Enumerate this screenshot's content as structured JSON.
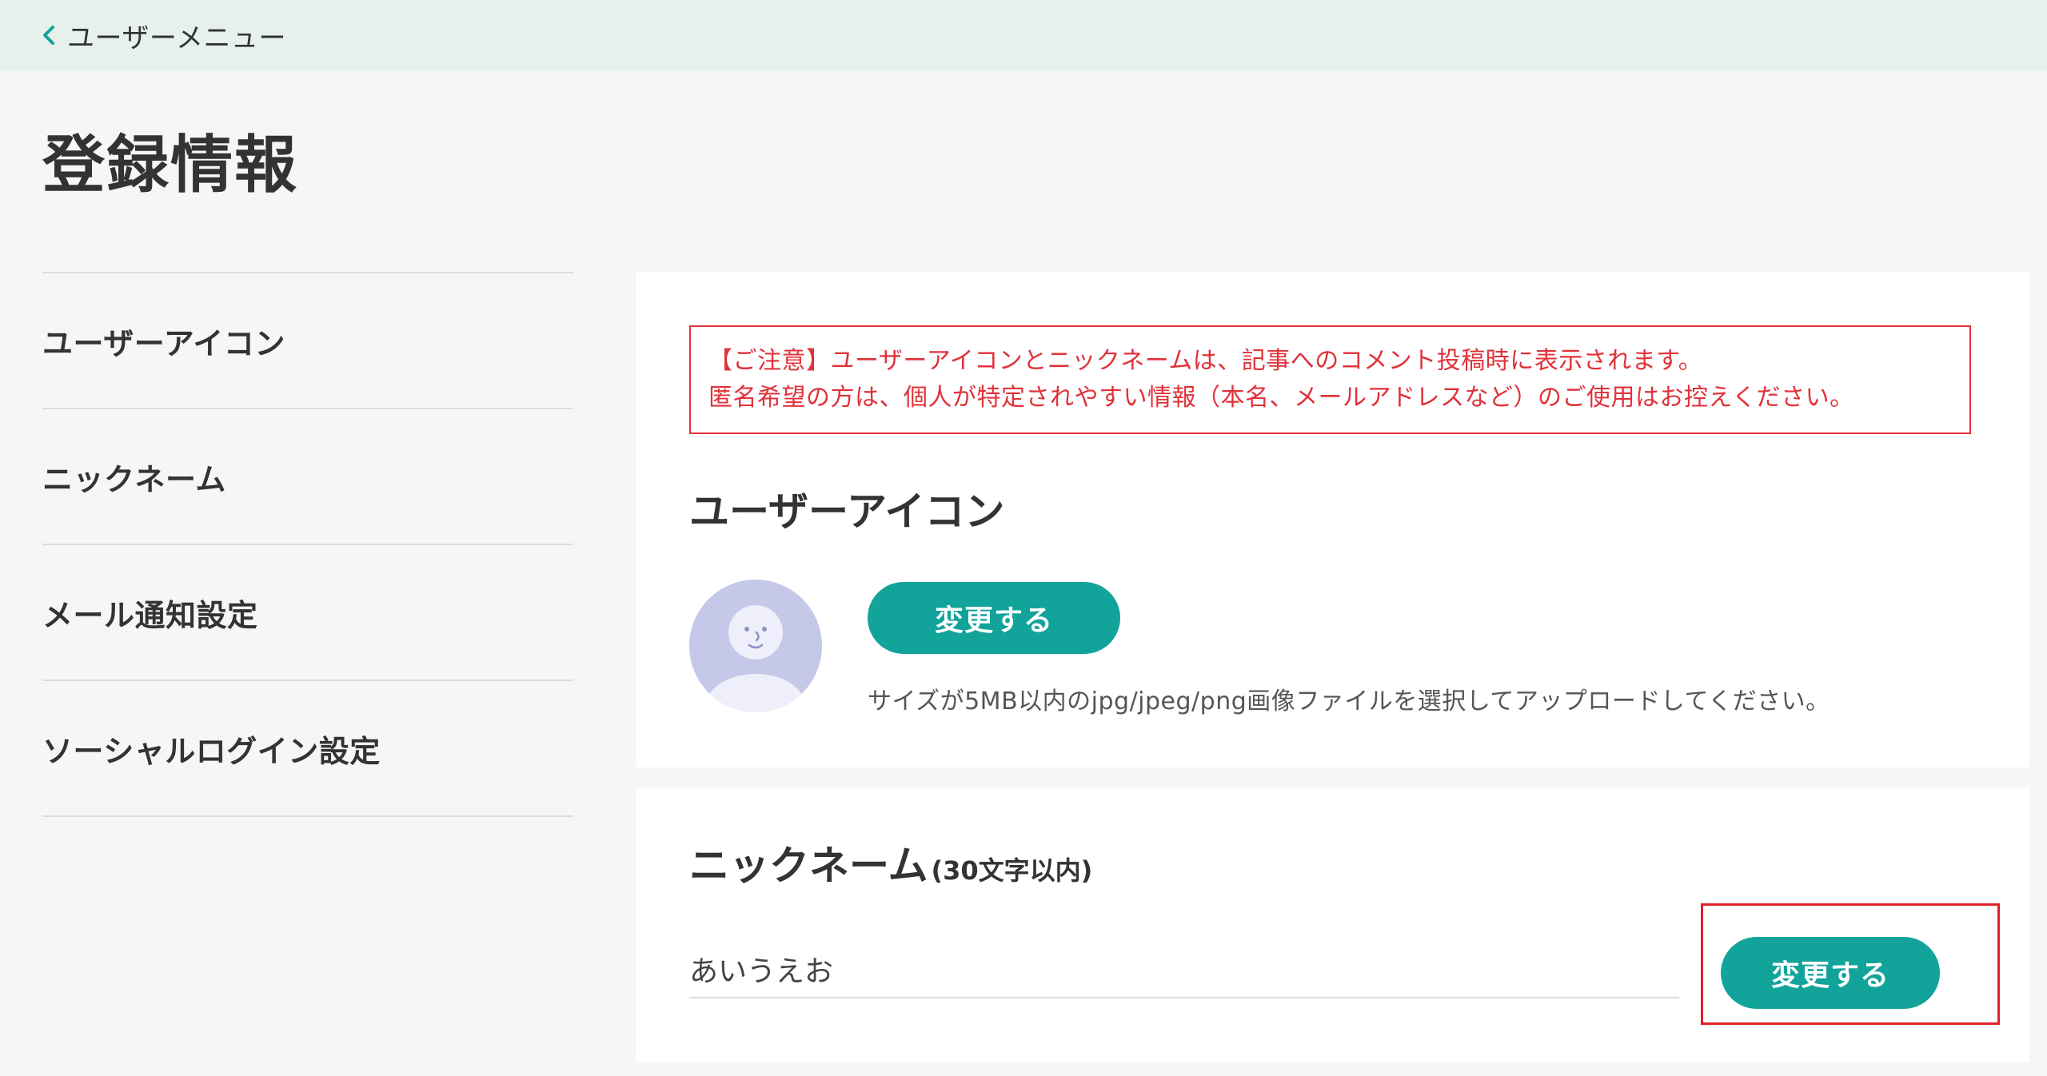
{
  "topbar": {
    "back_icon": "chevron-left-icon",
    "back_label": "ユーザーメニュー"
  },
  "page": {
    "title": "登録情報"
  },
  "sidebar": {
    "items": [
      {
        "label": "ユーザーアイコン"
      },
      {
        "label": "ニックネーム"
      },
      {
        "label": "メール通知設定"
      },
      {
        "label": "ソーシャルログイン設定"
      }
    ]
  },
  "icon_section": {
    "notice_line1": "【ご注意】ユーザーアイコンとニックネームは、記事へのコメント投稿時に表示されます。",
    "notice_line2": "匿名希望の方は、個人が特定されやすい情報（本名、メールアドレスなど）のご使用はお控えください。",
    "title": "ユーザーアイコン",
    "avatar_icon": "default-avatar-icon",
    "change_button": "変更する",
    "help_text": "サイズが5MB以内のjpg/jpeg/png画像ファイルを選択してアップロードしてください。"
  },
  "nickname_section": {
    "title": "ニックネーム",
    "title_note": "(30文字以内)",
    "value": "あいうえお",
    "change_button": "変更する"
  },
  "colors": {
    "accent": "#12a39b",
    "notice": "#e0323a",
    "highlight": "#e01f26",
    "topbar_bg": "#e6f1ec",
    "page_bg": "#f4f7f6",
    "avatar_bg": "#c6c8ea"
  }
}
